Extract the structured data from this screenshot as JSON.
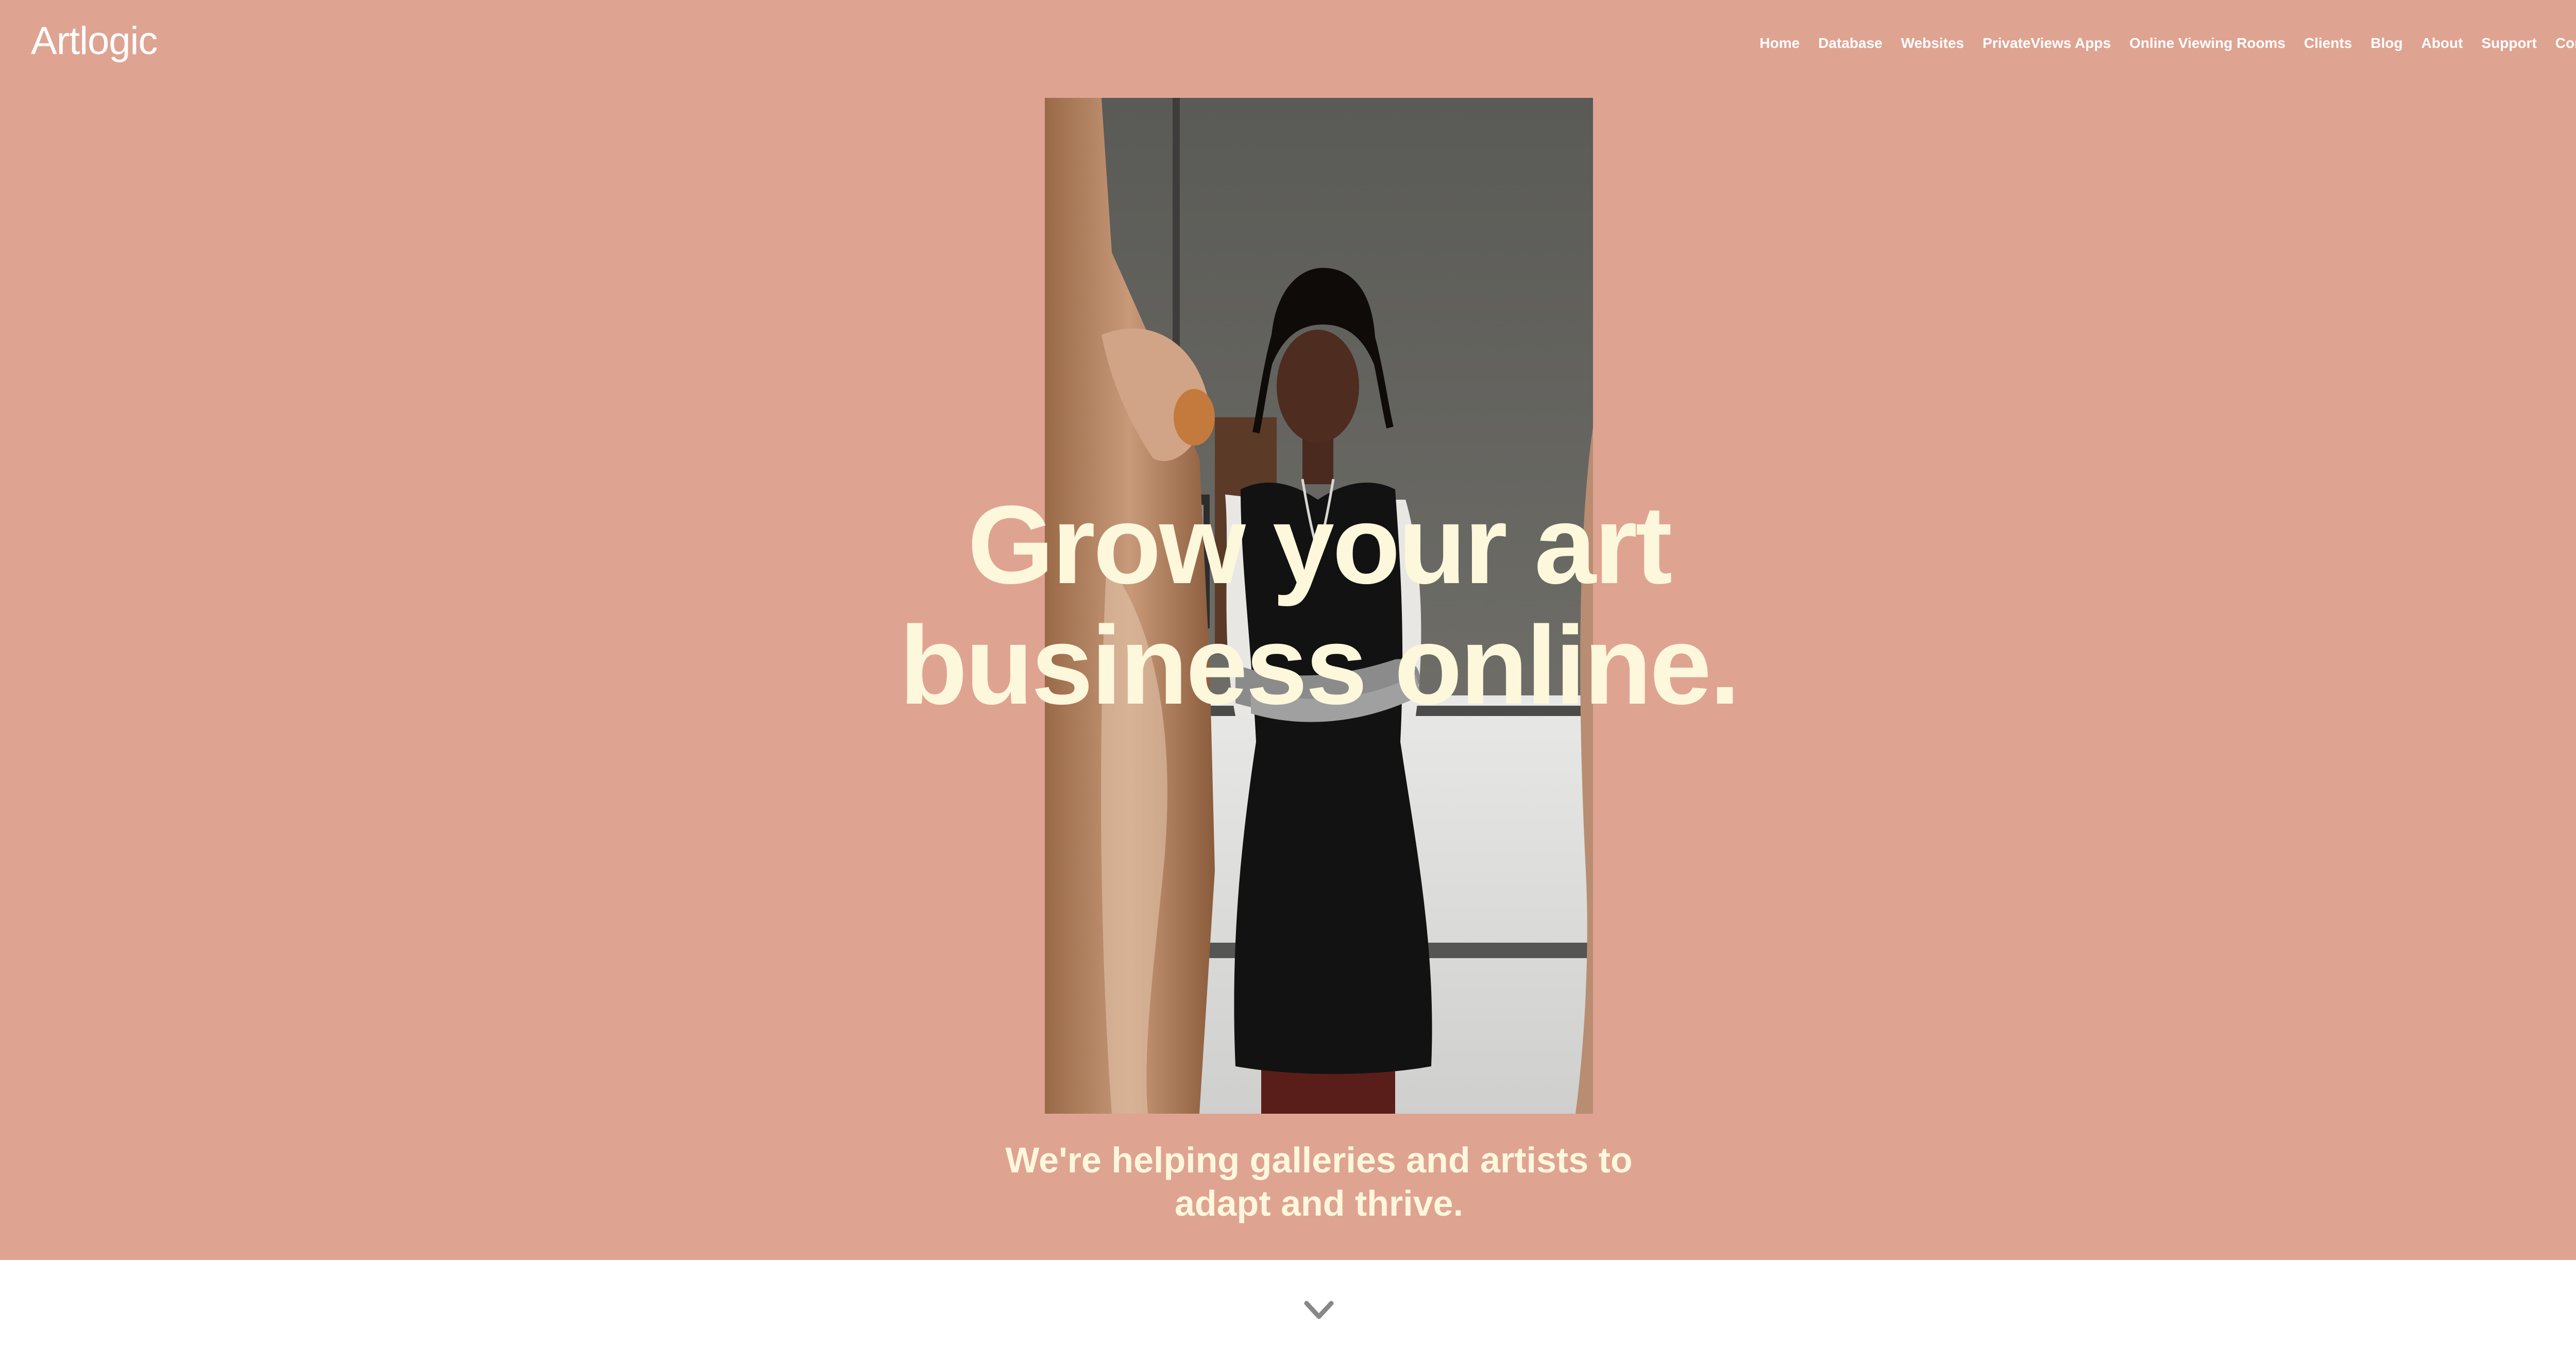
{
  "header": {
    "logo_text": "Artlogic",
    "nav": [
      {
        "label": "Home"
      },
      {
        "label": "Database"
      },
      {
        "label": "Websites"
      },
      {
        "label": "PrivateViews Apps"
      },
      {
        "label": "Online Viewing Rooms"
      },
      {
        "label": "Clients"
      },
      {
        "label": "Blog"
      },
      {
        "label": "About"
      },
      {
        "label": "Support"
      },
      {
        "label": "Contact"
      }
    ]
  },
  "hero": {
    "headline_line1": "Grow your art",
    "headline_line2": "business online.",
    "subline_line1": "We're helping galleries and artists to",
    "subline_line2": "adapt and thrive.",
    "scroll_icon": "chevron-down-icon"
  },
  "colors": {
    "hero_background": "#dfa392",
    "headline": "#fdf7dc",
    "nav_text": "#ffffff",
    "page_background": "#ffffff",
    "chevron": "#888888"
  }
}
